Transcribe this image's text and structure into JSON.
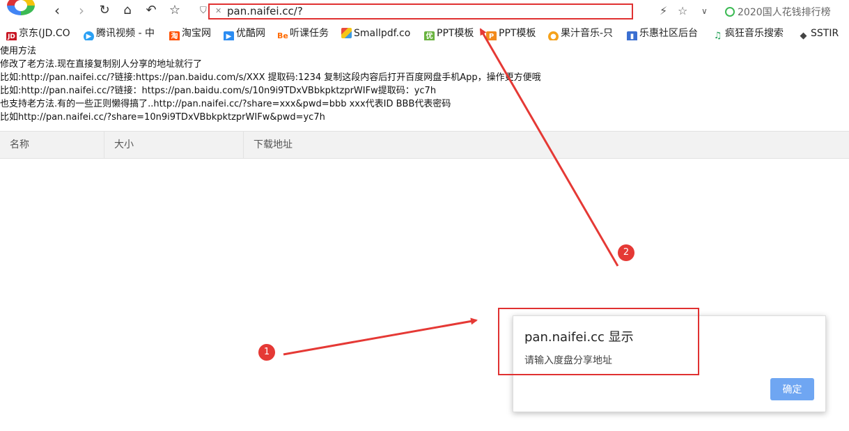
{
  "browser": {
    "address_url": "pan.naifei.cc/?",
    "hot_search": "2020国人花钱排行榜",
    "icons": [
      "back-icon",
      "forward-icon",
      "refresh-icon",
      "home-icon",
      "undo-icon",
      "star-icon",
      "shield-icon",
      "lightning-icon",
      "favorite-icon",
      "chevron-down-icon"
    ]
  },
  "bookmarks": [
    {
      "label": "京东(JD.CO",
      "icon": "JD",
      "color": "#c81623"
    },
    {
      "label": "腾讯视频 - 中",
      "icon": "▶",
      "color": "#2aa0f4"
    },
    {
      "label": "淘宝网",
      "icon": "淘",
      "color": "#ff5000"
    },
    {
      "label": "优酷网",
      "icon": "▶",
      "color": "#2b8cf2"
    },
    {
      "label": "听课任务",
      "icon": "Be",
      "color": "#ff6a00"
    },
    {
      "label": "Smallpdf.co",
      "icon": "",
      "color": "#e94b3c"
    },
    {
      "label": "PPT模板",
      "icon": "优",
      "color": "#69b33f"
    },
    {
      "label": "PPT模板",
      "icon": "P",
      "color": "#f28a1c"
    },
    {
      "label": "果汁音乐-只",
      "icon": "●",
      "color": "#f5a21b"
    },
    {
      "label": "乐惠社区后台",
      "icon": "▮",
      "color": "#3b6fd1"
    },
    {
      "label": "疯狂音乐搜索",
      "icon": "♫",
      "color": "#1e9e52"
    },
    {
      "label": "SSTIR",
      "icon": "◆",
      "color": "#444444"
    }
  ],
  "instructions": [
    "使用方法",
    "修改了老方法.现在直接复制别人分享的地址就行了",
    "比如:http://pan.naifei.cc/?链接:https://pan.baidu.com/s/XXX 提取码:1234 复制这段内容后打开百度网盘手机App，操作更方便哦",
    "比如:http://pan.naifei.cc/?链接：https://pan.baidu.com/s/10n9i9TDxVBbkpktzprWIFw提取码：yc7h",
    "也支持老方法.有的一些正则懒得搞了..http://pan.naifei.cc/?share=xxx&pwd=bbb xxx代表ID BBB代表密码",
    "比如http://pan.naifei.cc/?share=10n9i9TDxVBbkpktzprWIFw&pwd=yc7h"
  ],
  "table": {
    "headers": [
      "名称",
      "大小",
      "下载地址"
    ]
  },
  "dialog": {
    "title": "pan.naifei.cc 显示",
    "message": "请输入度盘分享地址",
    "ok_label": "确定"
  },
  "annotations": {
    "badge_1": "1",
    "badge_2": "2",
    "color": "#e03131"
  }
}
